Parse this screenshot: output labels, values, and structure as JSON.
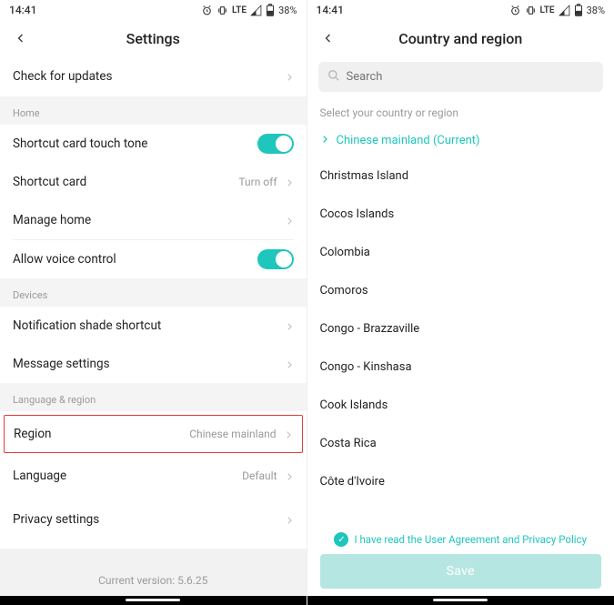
{
  "status": {
    "time": "14:41",
    "lte": "LTE",
    "battery_pct": "38%"
  },
  "left": {
    "title": "Settings",
    "check_updates": "Check for updates",
    "home_header": "Home",
    "shortcut_tone": "Shortcut card touch tone",
    "shortcut_card": "Shortcut card",
    "shortcut_card_value": "Turn off",
    "manage_home": "Manage home",
    "voice_control": "Allow voice control",
    "devices_header": "Devices",
    "notif_shade": "Notification shade shortcut",
    "message_settings": "Message settings",
    "lang_region_header": "Language & region",
    "region": "Region",
    "region_value": "Chinese mainland",
    "language": "Language",
    "language_value": "Default",
    "privacy": "Privacy settings",
    "version": "Current version: 5.6.25"
  },
  "right": {
    "title": "Country and region",
    "search_placeholder": "Search",
    "hint": "Select your country or region",
    "current": "Chinese mainland (Current)",
    "countries": [
      "Christmas Island",
      "Cocos Islands",
      "Colombia",
      "Comoros",
      "Congo - Brazzaville",
      "Congo - Kinshasa",
      "Cook Islands",
      "Costa Rica",
      "Côte d'Ivoire"
    ],
    "agree": "I have read the User Agreement and Privacy Policy",
    "save": "Save"
  }
}
